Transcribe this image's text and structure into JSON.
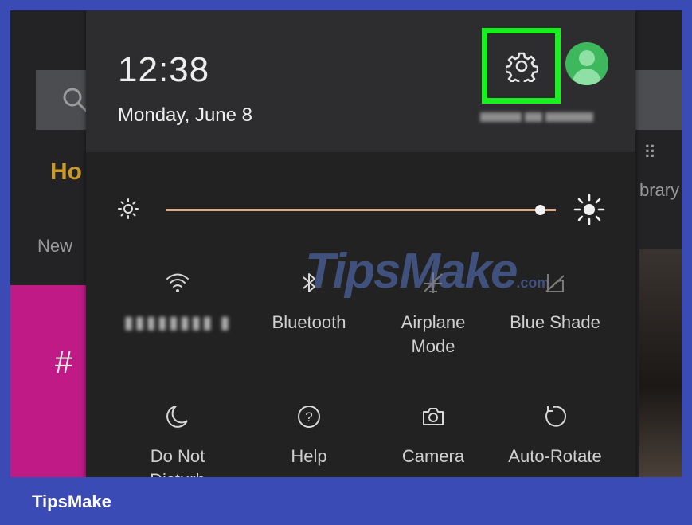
{
  "background_app": {
    "home_label": "Ho",
    "new_label": "New",
    "library_label": "brary",
    "promo_text": "#"
  },
  "header": {
    "time": "12:38",
    "date": "Monday, June 8",
    "settings_icon": "gear-icon",
    "highlight_color": "#19f020",
    "avatar_icon": "person-icon"
  },
  "brightness": {
    "level": 0.96,
    "low_icon": "sun-small-icon",
    "high_icon": "sun-large-icon",
    "track_color": "#d7ab8a"
  },
  "quick_tiles": [
    {
      "icon": "wifi-icon",
      "label": ""
    },
    {
      "icon": "bluetooth-icon",
      "label": "Bluetooth"
    },
    {
      "icon": "airplane-icon",
      "label": "Airplane Mode"
    },
    {
      "icon": "blue-shade-icon",
      "label": "Blue Shade"
    },
    {
      "icon": "moon-icon",
      "label": "Do Not Disturb"
    },
    {
      "icon": "help-icon",
      "label": "Help"
    },
    {
      "icon": "camera-icon",
      "label": "Camera"
    },
    {
      "icon": "rotate-icon",
      "label": "Auto-Rotate"
    }
  ],
  "watermark": {
    "main": "TipsMake",
    "suffix": ".com"
  },
  "footer": {
    "brand": "TipsMake"
  }
}
